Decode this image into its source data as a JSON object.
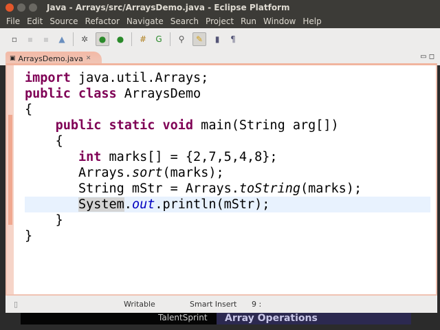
{
  "window": {
    "title": "Java - Arrays/src/ArraysDemo.java - Eclipse Platform"
  },
  "menu": [
    "File",
    "Edit",
    "Source",
    "Refactor",
    "Navigate",
    "Search",
    "Project",
    "Run",
    "Window",
    "Help"
  ],
  "toolbar": {
    "icons": [
      "new-icon",
      "save-icon",
      "save-all-icon",
      "print-icon",
      "debug-icon",
      "run-icon",
      "run-external-icon",
      "new-package-icon",
      "new-class-icon",
      "open-type-icon",
      "mark-occurrences-icon",
      "toggle-block-icon",
      "show-whitespace-icon"
    ]
  },
  "editor": {
    "tab_label": "ArraysDemo.java",
    "tab_close": "✕",
    "lines": {
      "l1a": "import",
      "l1b": " java.util.Arrays;",
      "l2a": "public class",
      "l2b": " ArraysDemo",
      "l3": "{",
      "l4a": "public static void",
      "l4b": " main(String arg[])",
      "l5": "{",
      "l6a": "int",
      "l6b": " marks[] = {2,7,5,4,8};",
      "l7a": "Arrays.",
      "l7b": "sort",
      "l7c": "(marks);",
      "l8a": "String mStr = Arrays.",
      "l8b": "toString",
      "l8c": "(marks);",
      "l9a": "System",
      "l9b": ".",
      "l9c": "out",
      "l9d": ".println(mStr);",
      "l10": "}",
      "l11": "}"
    }
  },
  "status": {
    "writable": "Writable",
    "insert_mode": "Smart Insert",
    "position": "9 :"
  },
  "banner": {
    "brand": "TalentSprint",
    "topic": "Array Operations"
  }
}
